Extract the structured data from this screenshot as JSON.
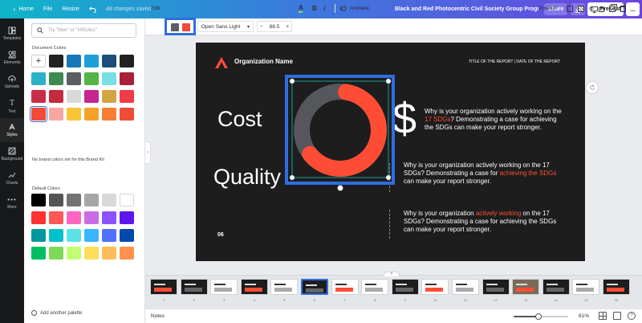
{
  "topbar": {
    "home": "Home",
    "file": "File",
    "resize": "Resize",
    "saved_status": "All changes saved",
    "doc_title": "Black and Red Photocentric Civil Society Group Progress Re...",
    "share": "Share",
    "present": "Present",
    "more": "..."
  },
  "rail": [
    {
      "label": "Templates",
      "icon": "templates-icon"
    },
    {
      "label": "Elements",
      "icon": "elements-icon"
    },
    {
      "label": "Uploads",
      "icon": "upload-icon"
    },
    {
      "label": "Text",
      "icon": "text-icon"
    },
    {
      "label": "Styles",
      "icon": "styles-icon"
    },
    {
      "label": "Background",
      "icon": "background-icon"
    },
    {
      "label": "Charts",
      "icon": "charts-icon"
    },
    {
      "label": "More",
      "icon": "more-icon"
    }
  ],
  "panel": {
    "search_placeholder": "Try \"blue\" or \"#00c4cc\"",
    "document_colors_label": "Document Colors",
    "document_colors": [
      "#222222",
      "#1778b7",
      "#1ea0d6",
      "#1b4f7a",
      "#222222",
      "#2bb2c7",
      "#3c8a4e",
      "#5b5e63",
      "#55b447",
      "#77e0e6",
      "#a82038",
      "#c82d4a",
      "#c62a3e",
      "#d9d9d9",
      "#c7268f",
      "#d2a442",
      "#ef3c46",
      "#ef4b36",
      "#f7a6a2",
      "#f7c536",
      "#f5a22b",
      "#f47f33",
      "#ef4b36"
    ],
    "no_brand": "No brand colors set for this Brand Kit",
    "default_colors_label": "Default Colors",
    "default_colors": [
      "#000000",
      "#545454",
      "#737373",
      "#a6a6a6",
      "#d9d9d9",
      "#ffffff",
      "#ff3131",
      "#ff5757",
      "#ff66c4",
      "#cb6ce6",
      "#8c52ff",
      "#5e17eb",
      "#03989e",
      "#00c2cb",
      "#5ce1e6",
      "#38b6ff",
      "#5271ff",
      "#004aad",
      "#00bf63",
      "#7ed957",
      "#c1ff72",
      "#ffde59",
      "#ffbd59",
      "#ff914d"
    ],
    "add_palette": "Add another palette"
  },
  "toolbar": {
    "edit": "Edit",
    "font": "Open Sans Light",
    "font_size": "88.5",
    "animate": "Animate",
    "position": "Position",
    "selected_colors": [
      "#5b5e63",
      "#ef4b36"
    ]
  },
  "slide": {
    "org_name": "Organization Name",
    "header_right": "TITLE OF THE REPORT | DATE OF THE REPORT",
    "cost": "Cost",
    "quality": "Quality",
    "page_num": "06",
    "dollar": "$",
    "p1_a": "Why is your organization actively working on the ",
    "p1_red": "17 SDGs",
    "p1_b": "? Demonstrating a case for achieving the SDGs can make your report stronger.",
    "p2_a": "Why is your organization actively working on the 17 SDGs? Demonstrating a case for ",
    "p2_red": "achieving the SDGs",
    "p2_b": " can make your report stronger.",
    "p3_a": "Why is your organization ",
    "p3_red": "actively working",
    "p3_b": " on the 17 SDGs? Demonstrating a case for achieving the SDGs can make your report stronger.",
    "donut_fraction": 0.62,
    "colors": {
      "red": "#ff4d35",
      "grey": "#55575c",
      "selection": "#2f6ee0"
    }
  },
  "thumbnails": [
    {
      "num": "1",
      "bg": "#1d1d1d"
    },
    {
      "num": "2",
      "bg": "#1d1d1d"
    },
    {
      "num": "3",
      "bg": "#ffffff"
    },
    {
      "num": "4",
      "bg": "#1d1d1d"
    },
    {
      "num": "5",
      "bg": "#ffffff"
    },
    {
      "num": "6",
      "bg": "#1d1d1d"
    },
    {
      "num": "7",
      "bg": "#ffffff"
    },
    {
      "num": "8",
      "bg": "#ffffff"
    },
    {
      "num": "9",
      "bg": "#1d1d1d"
    },
    {
      "num": "10",
      "bg": "#ffffff"
    },
    {
      "num": "11",
      "bg": "#ffffff"
    },
    {
      "num": "12",
      "bg": "#1d1d1d"
    },
    {
      "num": "13",
      "bg": "#7a6a5a"
    },
    {
      "num": "14",
      "bg": "#1d1d1d"
    },
    {
      "num": "15",
      "bg": "#ffffff"
    },
    {
      "num": "16",
      "bg": "#1d1d1d"
    }
  ],
  "status": {
    "notes": "Notes",
    "zoom": "61%",
    "zoom_fraction": 0.45
  }
}
